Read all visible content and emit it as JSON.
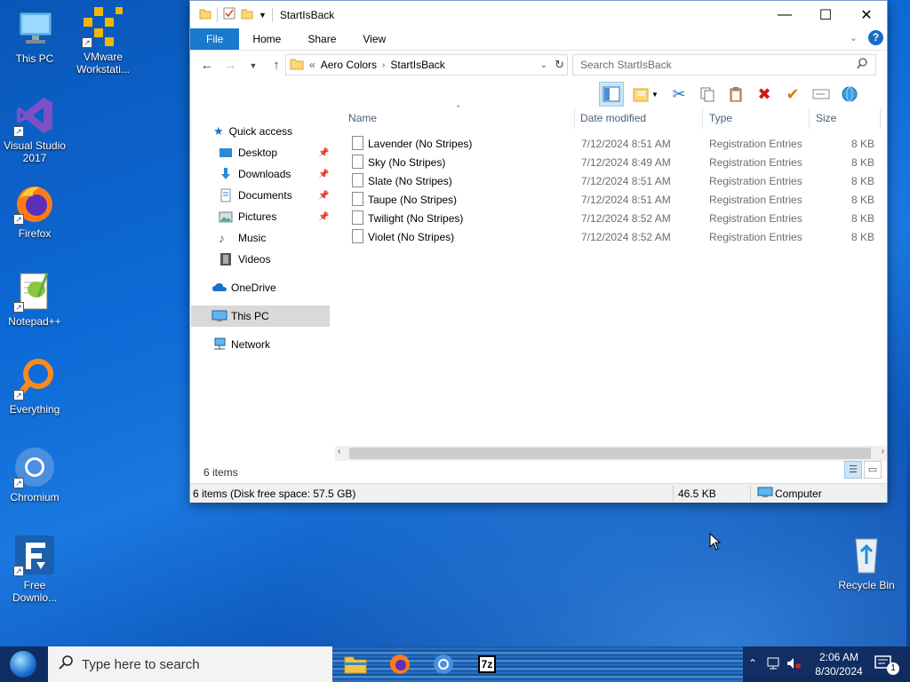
{
  "desktop": {
    "icons": [
      {
        "label": "This PC"
      },
      {
        "label": "VMware Workstati..."
      },
      {
        "label": "Visual Studio 2017"
      },
      {
        "label": "Firefox"
      },
      {
        "label": "Notepad++"
      },
      {
        "label": "Everything"
      },
      {
        "label": "Chromium"
      },
      {
        "label": "Free Downlo..."
      },
      {
        "label": "Recycle Bin"
      }
    ]
  },
  "window": {
    "title": "StartIsBack",
    "ribbon_tabs": [
      "File",
      "Home",
      "Share",
      "View"
    ],
    "help_label": "?",
    "address": {
      "overflow": "«",
      "segments": [
        "Aero Colors",
        "StartIsBack"
      ]
    },
    "search_placeholder": "Search StartIsBack",
    "columns": {
      "name": "Name",
      "date": "Date modified",
      "type": "Type",
      "size": "Size"
    },
    "nav": {
      "quick_access": "Quick access",
      "desktop": "Desktop",
      "downloads": "Downloads",
      "documents": "Documents",
      "pictures": "Pictures",
      "music": "Music",
      "videos": "Videos",
      "onedrive": "OneDrive",
      "this_pc": "This PC",
      "network": "Network"
    },
    "files": [
      {
        "name": "Lavender (No Stripes)",
        "date": "7/12/2024 8:51 AM",
        "type": "Registration Entries",
        "size": "8 KB"
      },
      {
        "name": "Sky (No Stripes)",
        "date": "7/12/2024 8:49 AM",
        "type": "Registration Entries",
        "size": "8 KB"
      },
      {
        "name": "Slate (No Stripes)",
        "date": "7/12/2024 8:51 AM",
        "type": "Registration Entries",
        "size": "8 KB"
      },
      {
        "name": "Taupe (No Stripes)",
        "date": "7/12/2024 8:51 AM",
        "type": "Registration Entries",
        "size": "8 KB"
      },
      {
        "name": "Twilight (No Stripes)",
        "date": "7/12/2024 8:52 AM",
        "type": "Registration Entries",
        "size": "8 KB"
      },
      {
        "name": "Violet (No Stripes)",
        "date": "7/12/2024 8:52 AM",
        "type": "Registration Entries",
        "size": "8 KB"
      }
    ],
    "items_count": "6 items",
    "status": {
      "left": "6 items (Disk free space: 57.5 GB)",
      "size": "46.5 KB",
      "location": "Computer"
    }
  },
  "taskbar": {
    "search_placeholder": "Type here to search",
    "time": "2:06 AM",
    "date": "8/30/2024",
    "notification_count": "1"
  },
  "colors": {
    "accent": "#1979ca",
    "selection": "#d9d9d9",
    "taskbar": "#10285a"
  }
}
